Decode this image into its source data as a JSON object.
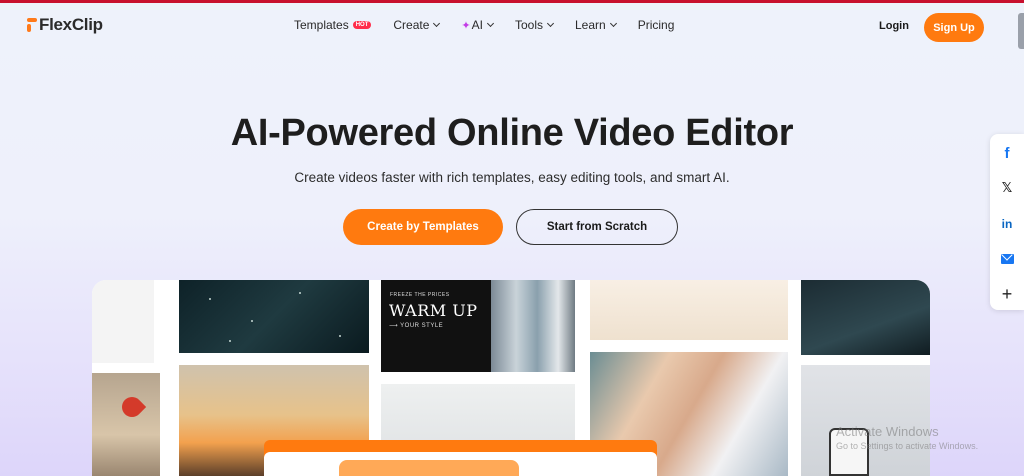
{
  "brand": {
    "name": "FlexClip",
    "accent": "#ff7a0f",
    "top_bar_color": "#c8102e"
  },
  "nav": {
    "items": [
      {
        "label": "Templates",
        "badge": "HOT",
        "has_chevron": false
      },
      {
        "label": "Create",
        "has_chevron": true
      },
      {
        "label": "AI",
        "icon": "sparkle-icon",
        "has_chevron": true
      },
      {
        "label": "Tools",
        "has_chevron": true
      },
      {
        "label": "Learn",
        "has_chevron": true
      },
      {
        "label": "Pricing",
        "has_chevron": false
      }
    ],
    "login_label": "Login",
    "signup_label": "Sign Up"
  },
  "hero": {
    "title": "AI-Powered Online Video Editor",
    "subtitle": "Create videos faster with rich templates, easy editing tools, and smart AI.",
    "primary_button": "Create by Templates",
    "secondary_button": "Start from Scratch"
  },
  "share": {
    "items": [
      {
        "name": "facebook-icon",
        "glyph": "f"
      },
      {
        "name": "x-icon",
        "glyph": "𝕏"
      },
      {
        "name": "linkedin-icon",
        "glyph": "in"
      },
      {
        "name": "mail-icon",
        "glyph": ""
      },
      {
        "name": "plus-icon",
        "glyph": "+"
      }
    ]
  },
  "collage": {
    "warm_card": {
      "small_text": "FREEZE THE PRICES",
      "big_text": "WARM UP",
      "style_text": "⟶ YOUR STYLE"
    }
  },
  "watermark": {
    "line1": "Activate Windows",
    "line2": "Go to Settings to activate Windows."
  }
}
